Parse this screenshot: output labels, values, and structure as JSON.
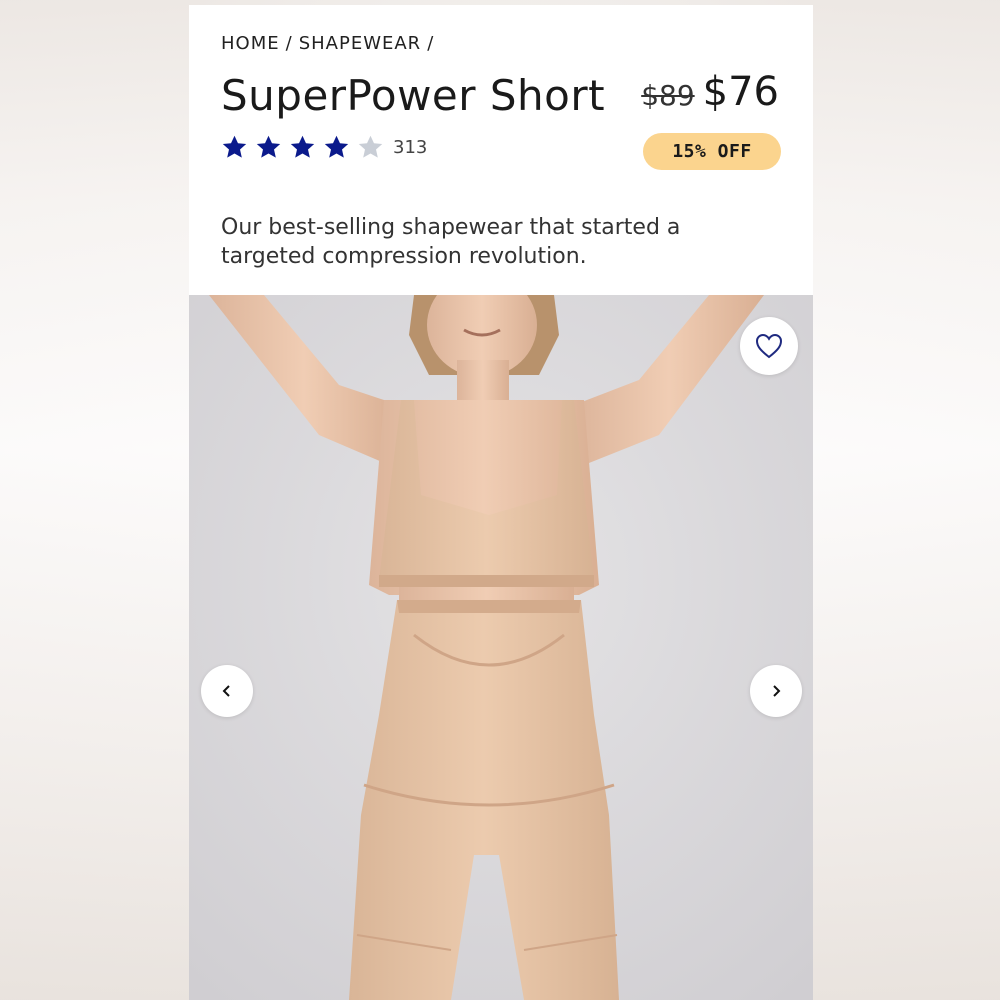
{
  "breadcrumb": {
    "items": [
      "HOME",
      "/",
      "SHAPEWEAR",
      "/"
    ]
  },
  "product": {
    "title": "SuperPower Short",
    "price_original": "$89",
    "price_current": "$76",
    "rating": 4,
    "rating_max": 5,
    "review_count": "313",
    "discount_badge": "15% OFF",
    "description": "Our best-selling shapewear that started a targeted compression revolution."
  },
  "colors": {
    "star_filled": "#0b1a8c",
    "star_empty": "#c9ced6",
    "badge_bg": "#fbd48e",
    "wishlist_icon": "#1f2a80"
  },
  "icons": {
    "wishlist": "heart-outline-icon",
    "prev": "chevron-left-icon",
    "next": "chevron-right-icon"
  }
}
